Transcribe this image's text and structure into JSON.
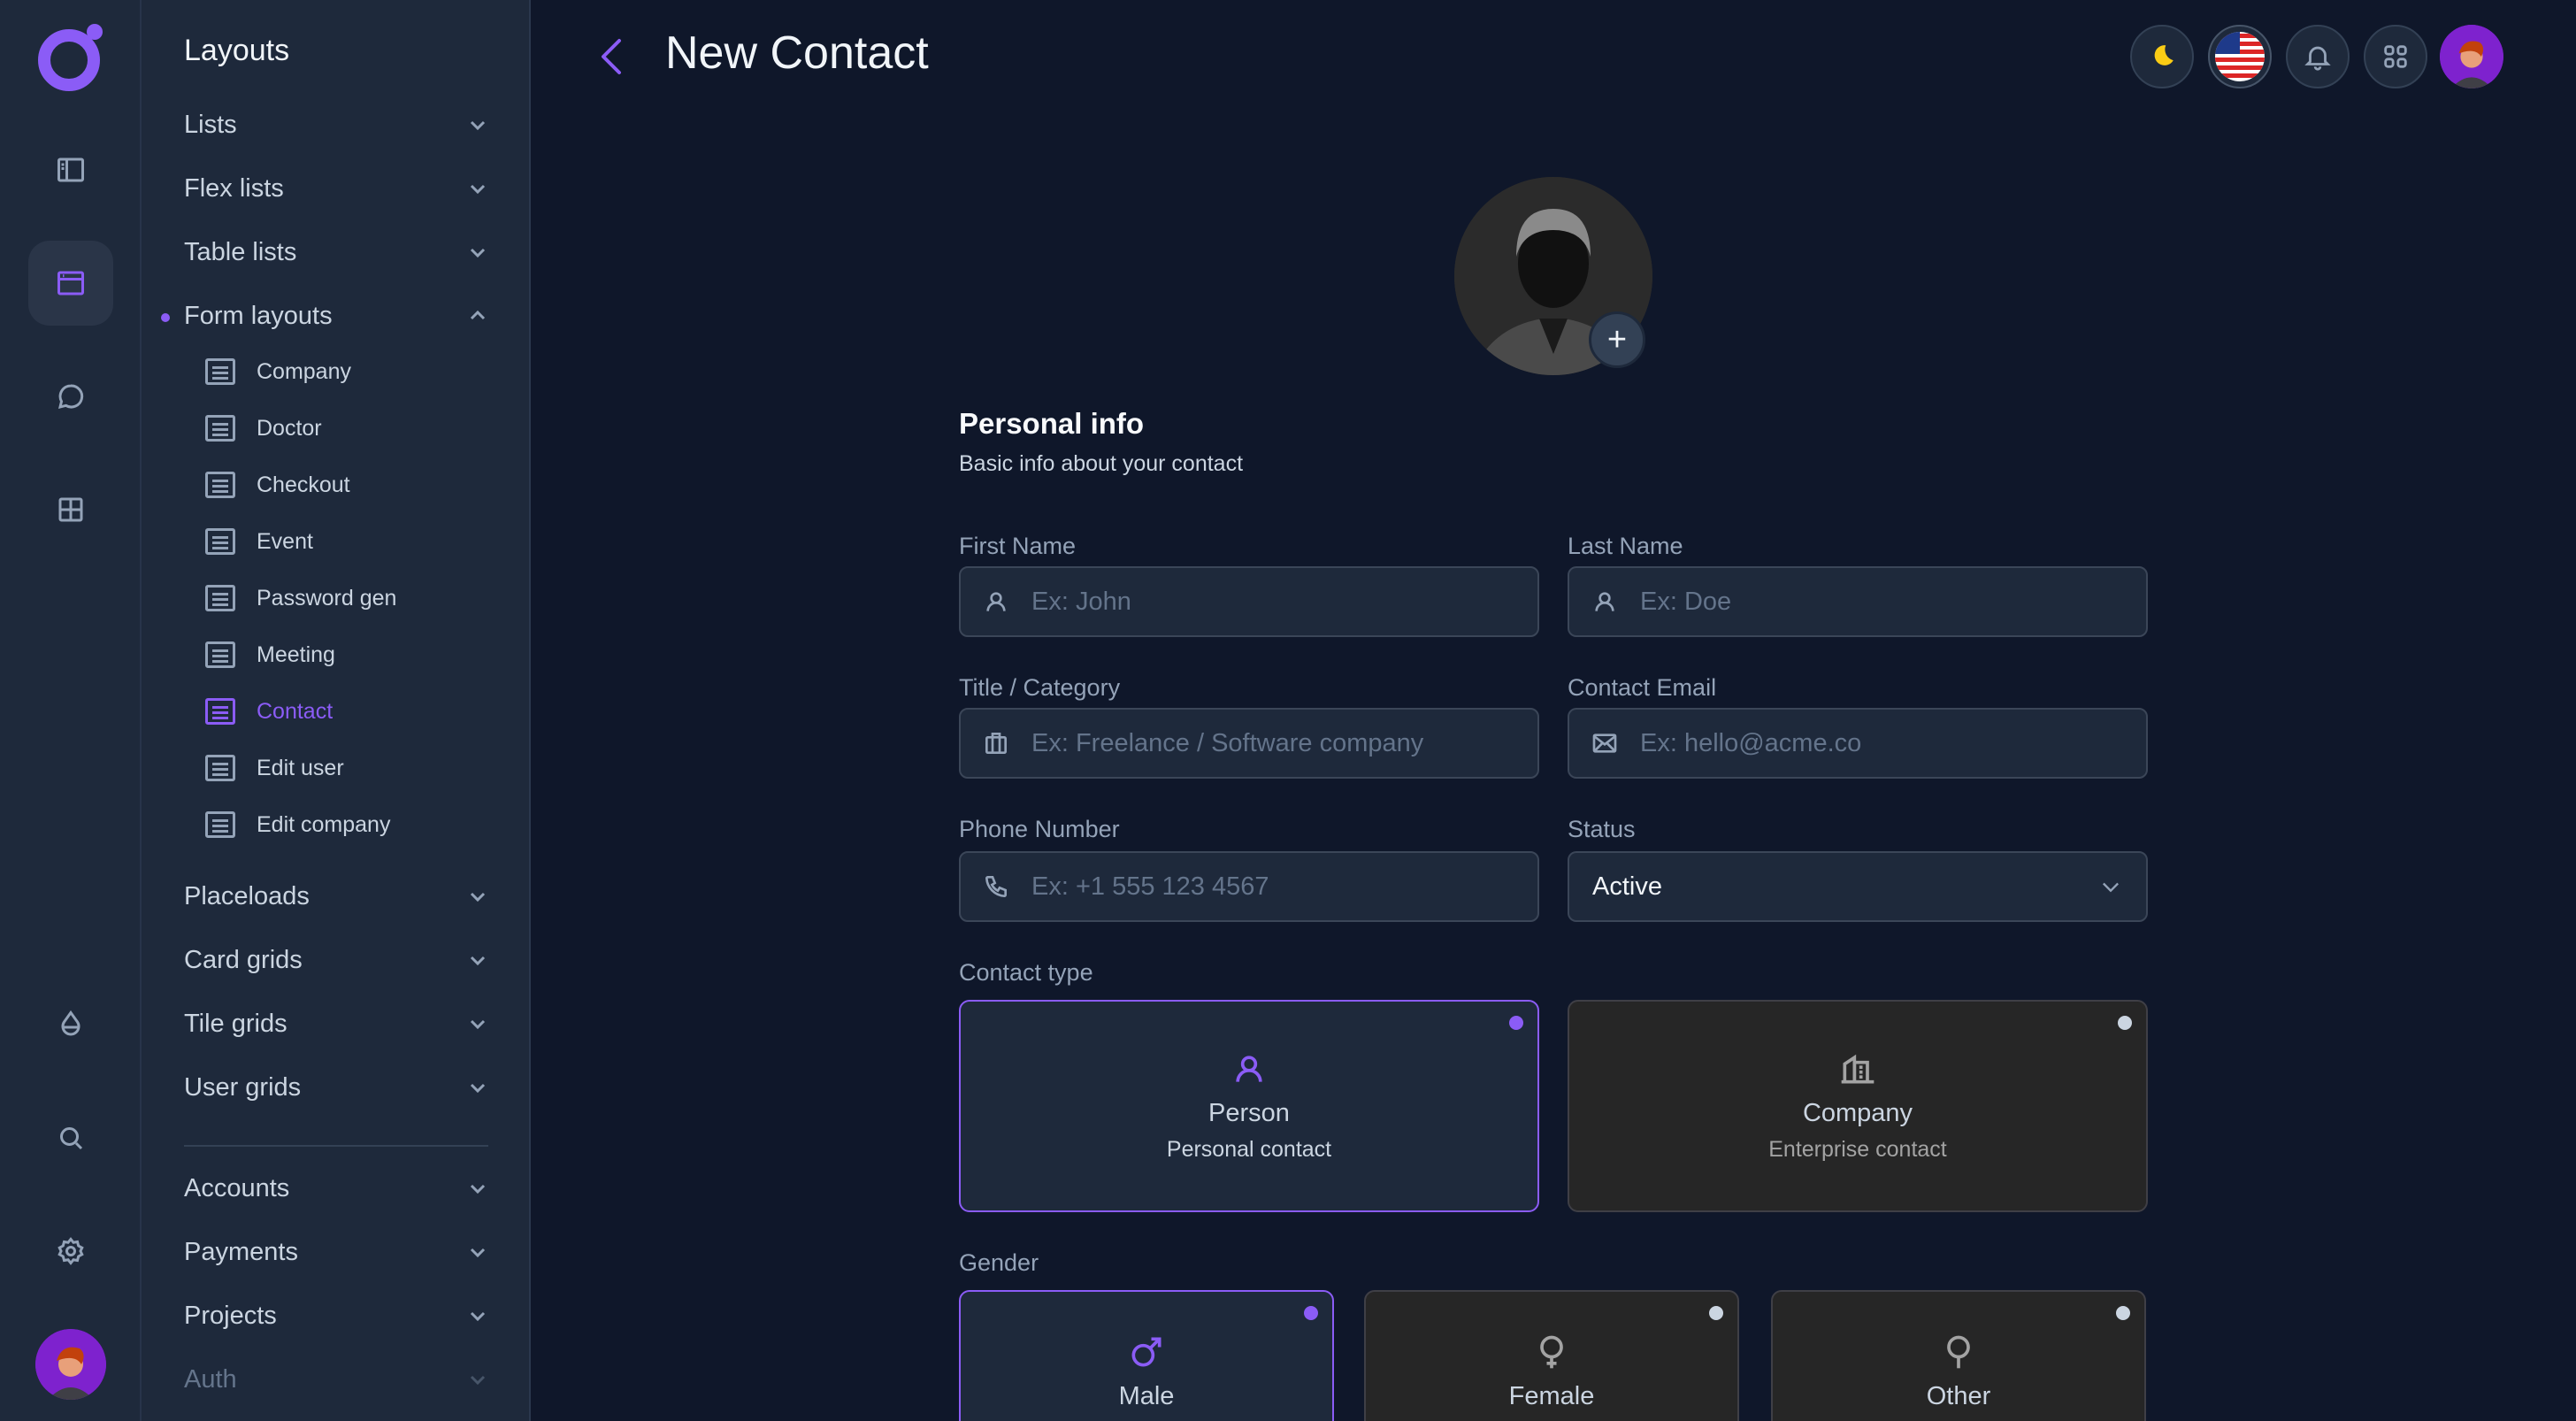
{
  "colors": {
    "accent": "#8b5cf6",
    "background": "#0f172a",
    "panel": "#1e293b"
  },
  "rail": {
    "icons": [
      "sidebar-icon",
      "layout-icon",
      "chat-icon",
      "grid-icon",
      "droplet-icon",
      "search-icon",
      "gear-icon"
    ]
  },
  "menu": {
    "title": "Layouts",
    "groups_top": [
      {
        "label": "Lists"
      },
      {
        "label": "Flex lists"
      },
      {
        "label": "Table lists"
      },
      {
        "label": "Form layouts"
      }
    ],
    "form_layouts": [
      {
        "label": "Company"
      },
      {
        "label": "Doctor"
      },
      {
        "label": "Checkout"
      },
      {
        "label": "Event"
      },
      {
        "label": "Password gen"
      },
      {
        "label": "Meeting"
      },
      {
        "label": "Contact"
      },
      {
        "label": "Edit user"
      },
      {
        "label": "Edit company"
      }
    ],
    "groups_mid": [
      {
        "label": "Placeloads"
      },
      {
        "label": "Card grids"
      },
      {
        "label": "Tile grids"
      },
      {
        "label": "User grids"
      }
    ],
    "groups_bottom": [
      {
        "label": "Accounts"
      },
      {
        "label": "Payments"
      },
      {
        "label": "Projects"
      },
      {
        "label": "Auth"
      }
    ]
  },
  "header": {
    "title": "New Contact"
  },
  "form": {
    "section_title": "Personal info",
    "section_subtitle": "Basic info about your contact",
    "first_name": {
      "label": "First Name",
      "placeholder": "Ex: John",
      "value": ""
    },
    "last_name": {
      "label": "Last Name",
      "placeholder": "Ex: Doe",
      "value": ""
    },
    "title": {
      "label": "Title / Category",
      "placeholder": "Ex: Freelance / Software company",
      "value": ""
    },
    "email": {
      "label": "Contact Email",
      "placeholder": "Ex: hello@acme.co",
      "value": ""
    },
    "phone": {
      "label": "Phone Number",
      "placeholder": "Ex: +1 555 123 4567",
      "value": ""
    },
    "status": {
      "label": "Status",
      "value": "Active"
    },
    "avatar_add_label": "+",
    "contact_type": {
      "label": "Contact type",
      "options": [
        {
          "title": "Person",
          "subtitle": "Personal contact",
          "selected": true
        },
        {
          "title": "Company",
          "subtitle": "Enterprise contact",
          "selected": false
        }
      ]
    },
    "gender": {
      "label": "Gender",
      "options": [
        {
          "title": "Male",
          "selected": true
        },
        {
          "title": "Female",
          "selected": false
        },
        {
          "title": "Other",
          "selected": false
        }
      ]
    }
  }
}
